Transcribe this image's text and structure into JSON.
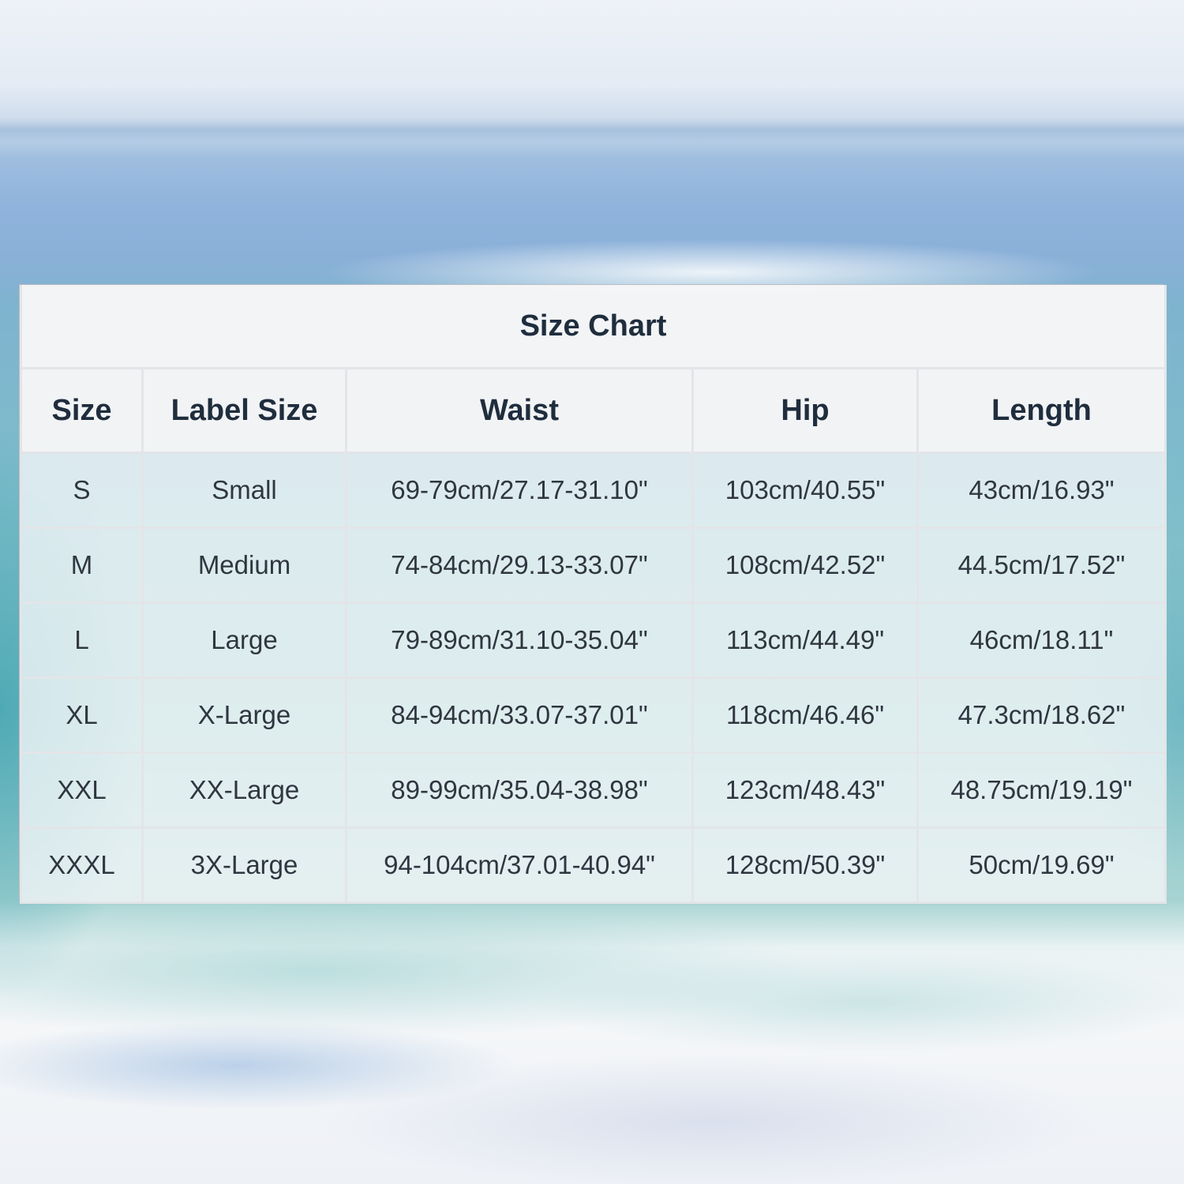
{
  "table": {
    "title": "Size Chart",
    "headers": [
      "Size",
      "Label Size",
      "Waist",
      "Hip",
      "Length"
    ],
    "rows": [
      [
        "S",
        "Small",
        "69-79cm/27.17-31.10\"",
        "103cm/40.55\"",
        "43cm/16.93\""
      ],
      [
        "M",
        "Medium",
        "74-84cm/29.13-33.07\"",
        "108cm/42.52\"",
        "44.5cm/17.52\""
      ],
      [
        "L",
        "Large",
        "79-89cm/31.10-35.04\"",
        "113cm/44.49\"",
        "46cm/18.11\""
      ],
      [
        "XL",
        "X-Large",
        "84-94cm/33.07-37.01\"",
        "118cm/46.46\"",
        "47.3cm/18.62\""
      ],
      [
        "XXL",
        "XX-Large",
        "89-99cm/35.04-38.98\"",
        "123cm/48.43\"",
        "48.75cm/19.19\""
      ],
      [
        "XXXL",
        "3X-Large",
        "94-104cm/37.01-40.94\"",
        "128cm/50.39\"",
        "50cm/19.69\""
      ]
    ]
  },
  "colors": {
    "text_dark": "#1f2d3d",
    "cell_border": "#e3e5e8",
    "cell_background": "#f6f7f9"
  }
}
